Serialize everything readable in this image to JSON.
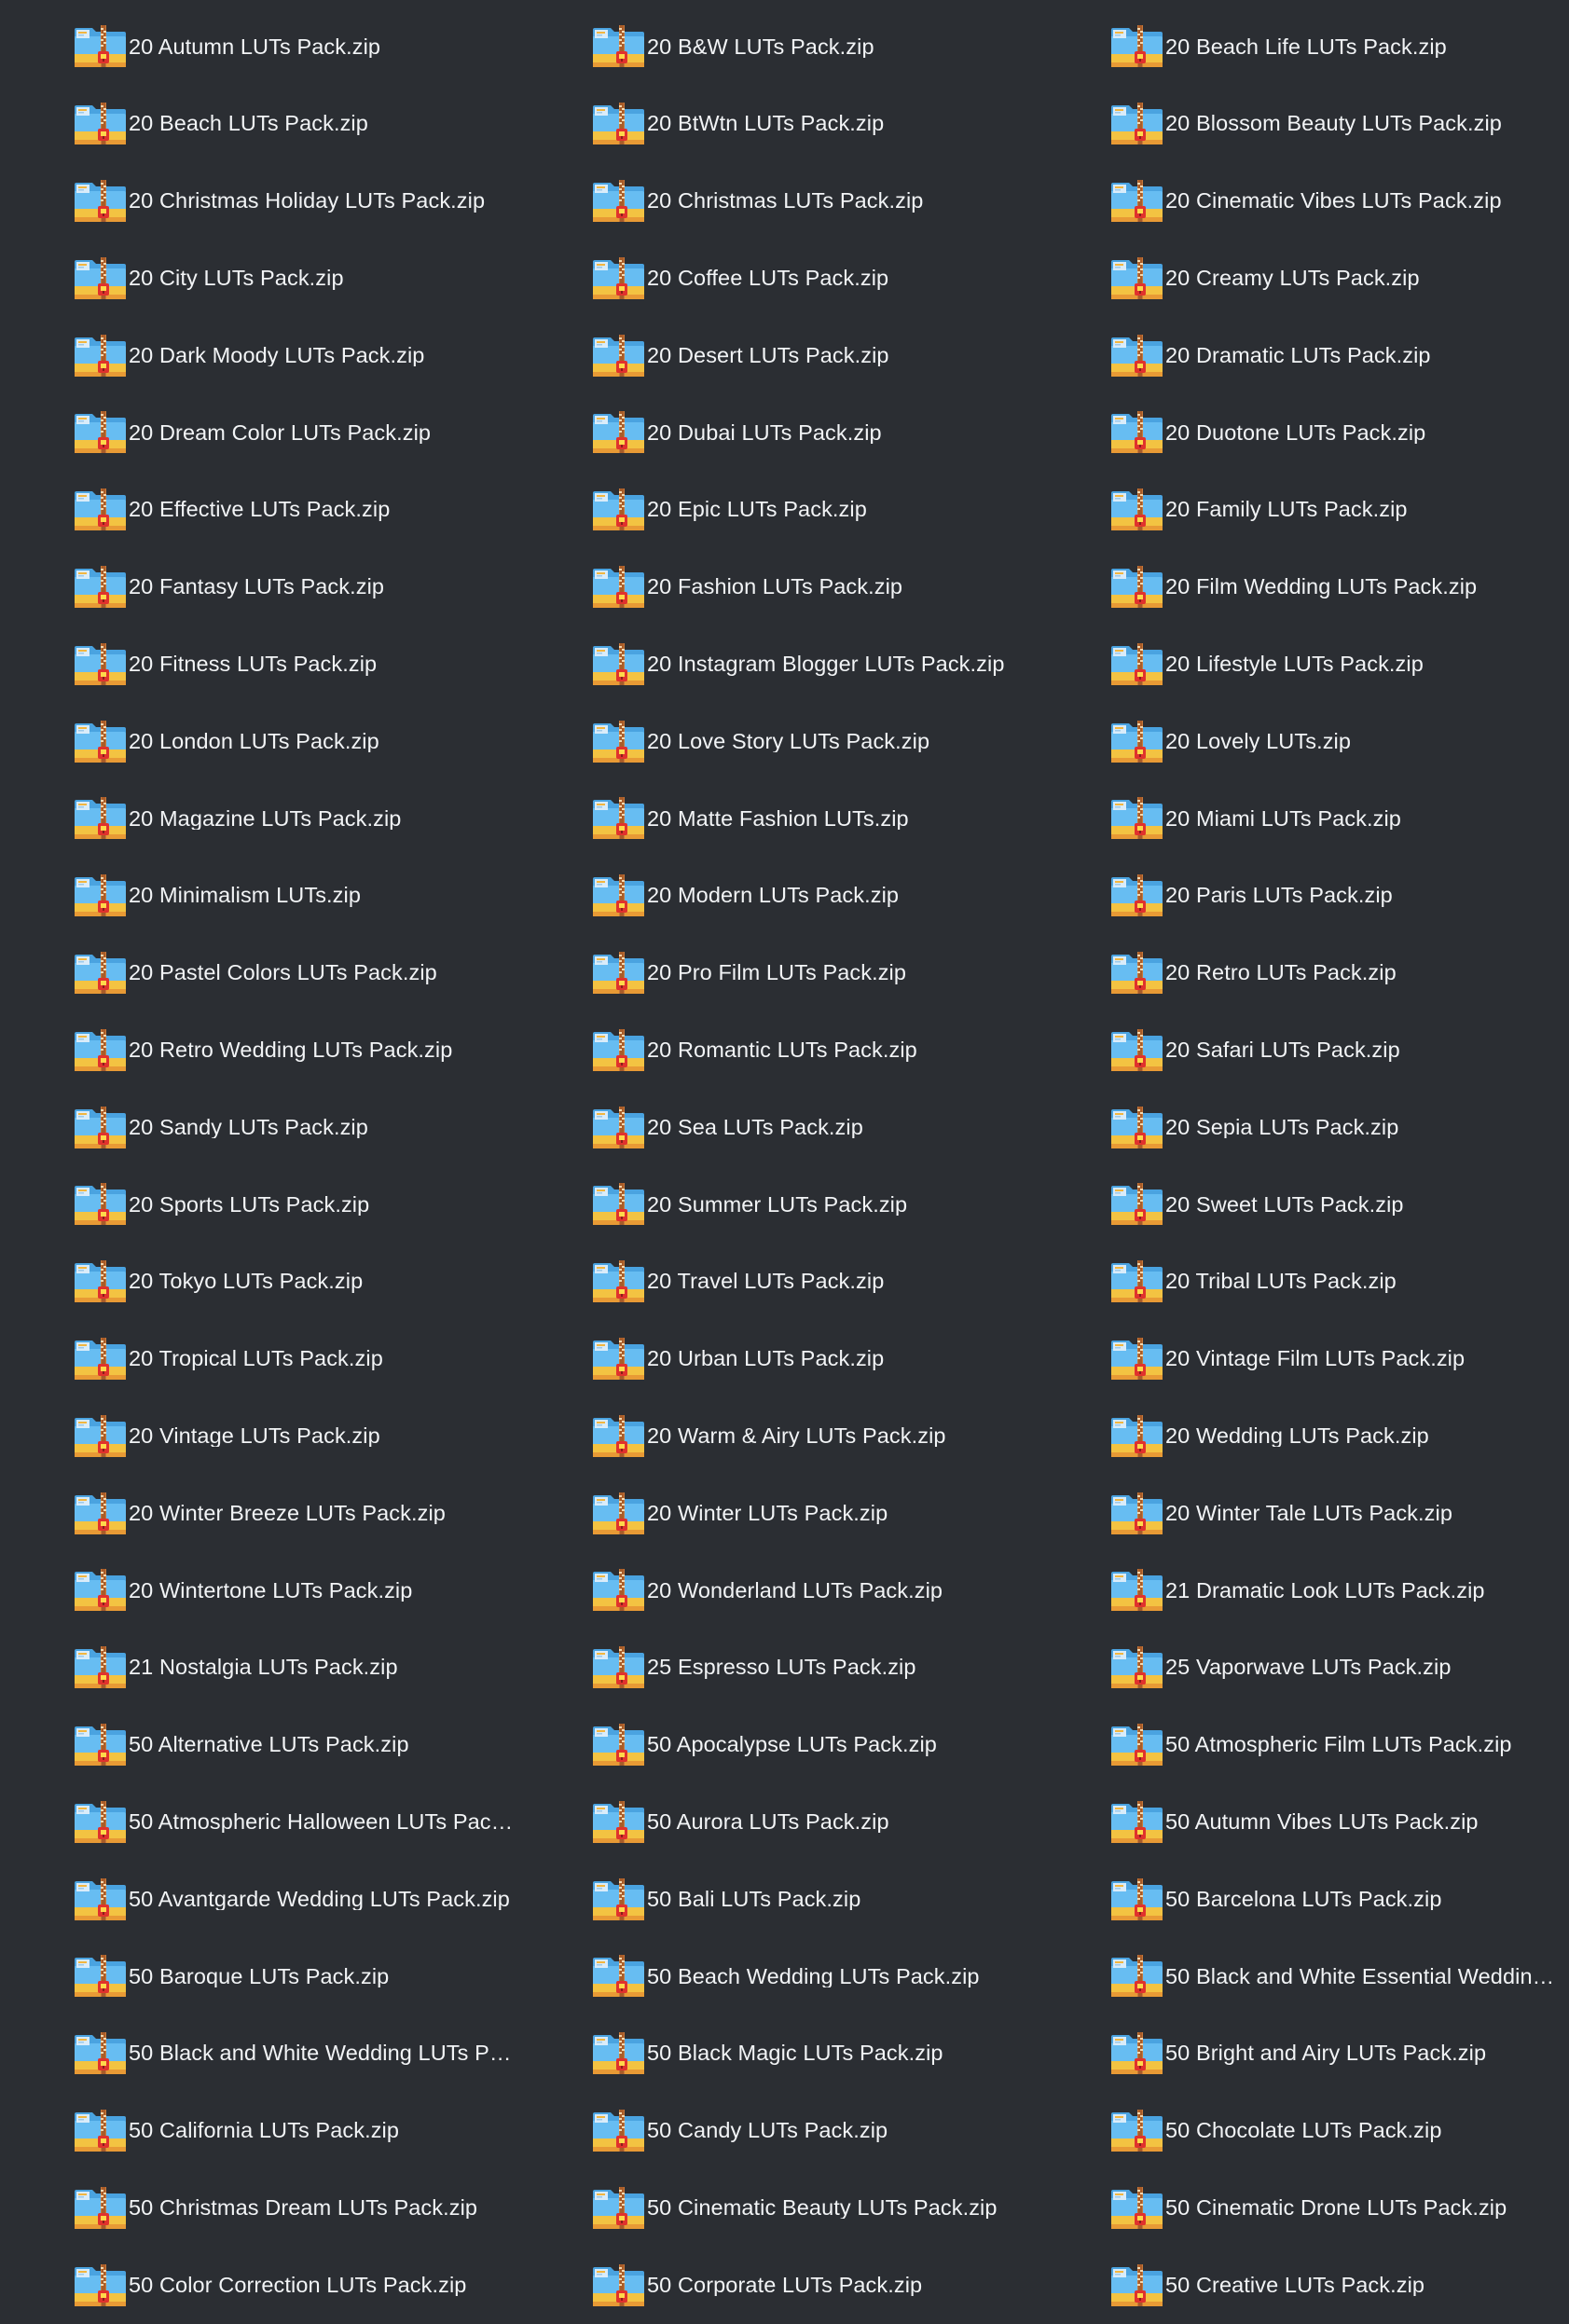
{
  "files": [
    "20 Autumn LUTs Pack.zip",
    "20 B&W LUTs Pack.zip",
    "20 Beach Life LUTs Pack.zip",
    "20 Beach LUTs Pack.zip",
    "20 BtWtn LUTs Pack.zip",
    "20 Blossom Beauty LUTs Pack.zip",
    "20 Christmas Holiday LUTs Pack.zip",
    "20 Christmas LUTs Pack.zip",
    "20 Cinematic Vibes LUTs Pack.zip",
    "20 City LUTs Pack.zip",
    "20 Coffee LUTs Pack.zip",
    "20 Creamy LUTs Pack.zip",
    "20 Dark Moody LUTs Pack.zip",
    "20 Desert LUTs Pack.zip",
    "20 Dramatic LUTs Pack.zip",
    "20 Dream Color LUTs Pack.zip",
    "20 Dubai LUTs Pack.zip",
    "20 Duotone LUTs Pack.zip",
    "20 Effective LUTs Pack.zip",
    "20 Epic LUTs Pack.zip",
    "20 Family LUTs Pack.zip",
    "20 Fantasy LUTs Pack.zip",
    "20 Fashion LUTs Pack.zip",
    "20 Film Wedding LUTs Pack.zip",
    "20 Fitness LUTs Pack.zip",
    "20 Instagram Blogger LUTs Pack.zip",
    "20 Lifestyle LUTs Pack.zip",
    "20 London LUTs Pack.zip",
    "20 Love Story LUTs Pack.zip",
    "20 Lovely LUTs.zip",
    "20 Magazine LUTs Pack.zip",
    "20 Matte Fashion LUTs.zip",
    "20 Miami LUTs Pack.zip",
    "20 Minimalism LUTs.zip",
    "20 Modern LUTs Pack.zip",
    "20 Paris LUTs Pack.zip",
    "20 Pastel Colors LUTs Pack.zip",
    "20 Pro Film LUTs Pack.zip",
    "20 Retro LUTs Pack.zip",
    "20 Retro Wedding LUTs Pack.zip",
    "20 Romantic LUTs Pack.zip",
    "20 Safari LUTs Pack.zip",
    "20 Sandy LUTs Pack.zip",
    "20 Sea LUTs Pack.zip",
    "20 Sepia LUTs Pack.zip",
    "20 Sports LUTs Pack.zip",
    "20 Summer LUTs Pack.zip",
    "20 Sweet LUTs Pack.zip",
    "20 Tokyo LUTs Pack.zip",
    "20 Travel LUTs Pack.zip",
    "20 Tribal LUTs Pack.zip",
    "20 Tropical LUTs Pack.zip",
    "20 Urban LUTs Pack.zip",
    "20 Vintage Film LUTs Pack.zip",
    "20 Vintage LUTs Pack.zip",
    "20 Warm & Airy LUTs Pack.zip",
    "20 Wedding LUTs Pack.zip",
    "20 Winter Breeze LUTs Pack.zip",
    "20 Winter LUTs Pack.zip",
    "20 Winter Tale LUTs Pack.zip",
    "20 Wintertone LUTs Pack.zip",
    "20 Wonderland LUTs Pack.zip",
    "21 Dramatic Look LUTs Pack.zip",
    "21 Nostalgia LUTs Pack.zip",
    "25 Espresso LUTs Pack.zip",
    "25 Vaporwave LUTs Pack.zip",
    "50 Alternative LUTs Pack.zip",
    "50 Apocalypse LUTs Pack.zip",
    "50 Atmospheric Film LUTs Pack.zip",
    "50 Atmospheric Halloween LUTs Pack.z...",
    "50 Aurora LUTs Pack.zip",
    "50 Autumn Vibes LUTs Pack.zip",
    "50 Avantgarde Wedding LUTs Pack.zip",
    "50 Bali LUTs Pack.zip",
    "50 Barcelona LUTs Pack.zip",
    "50 Baroque LUTs Pack.zip",
    "50 Beach Wedding LUTs Pack.zip",
    "50 Black and White Essential Wedding ...",
    "50 Black and White Wedding LUTs Pac...",
    "50 Black Magic LUTs Pack.zip",
    "50 Bright and Airy LUTs Pack.zip",
    "50 California LUTs Pack.zip",
    "50 Candy LUTs Pack.zip",
    "50 Chocolate LUTs Pack.zip",
    "50 Christmas Dream LUTs Pack.zip",
    "50 Cinematic Beauty LUTs Pack.zip",
    "50 Cinematic Drone LUTs Pack.zip",
    "50 Color Correction LUTs Pack.zip",
    "50 Corporate LUTs Pack.zip",
    "50 Creative LUTs Pack.zip"
  ]
}
